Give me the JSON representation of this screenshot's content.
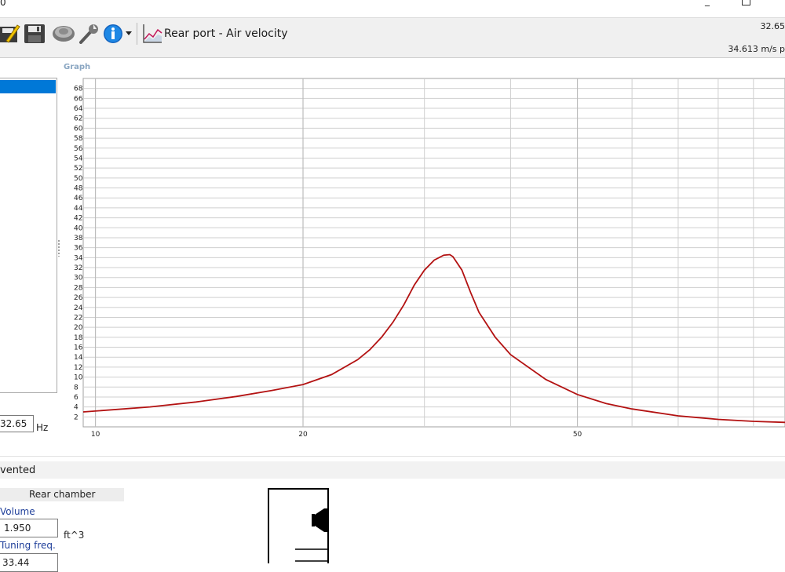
{
  "window": {
    "title_fragment": "0"
  },
  "toolbar": {
    "icons": [
      "edit-icon",
      "save-icon",
      "driver-icon",
      "wrench-icon",
      "info-icon",
      "chevron-down-icon",
      "graph-icon"
    ],
    "chart_title": "Rear port - Air velocity",
    "readout_freq": "32.65",
    "readout_velocity": "34.613 m/s p"
  },
  "graph": {
    "label": "Graph"
  },
  "left_panel": {
    "freq_value": "32.65",
    "freq_unit": "Hz"
  },
  "section": {
    "title": "vented",
    "rear_chamber": {
      "header": "Rear chamber",
      "volume_label": "Volume",
      "volume_value": "1.950",
      "volume_unit": "ft^3",
      "tuning_label": "Tuning freq.",
      "tuning_value": "33.44"
    }
  },
  "colors": {
    "curve": "#b31212",
    "selection": "#0078d7",
    "label_blue": "#1f3f9a",
    "graph_label": "#8aa6c2"
  },
  "chart_data": {
    "type": "line",
    "x_scale": "log",
    "xlim": [
      9.6,
      100
    ],
    "ylim": [
      0,
      70
    ],
    "x_tick_labels": [
      10,
      20,
      50
    ],
    "x_minor_lines": [
      30,
      40,
      60,
      70,
      80,
      90
    ],
    "y_ticks": [
      2,
      4,
      6,
      8,
      10,
      12,
      14,
      16,
      18,
      20,
      22,
      24,
      26,
      28,
      30,
      32,
      34,
      36,
      38,
      40,
      42,
      44,
      46,
      48,
      50,
      52,
      54,
      56,
      58,
      60,
      62,
      64,
      66,
      68
    ],
    "grid": true,
    "series": [
      {
        "color": "#b31212",
        "x": [
          9.6,
          12,
          14,
          16,
          18,
          20,
          22,
          24,
          25,
          26,
          27,
          28,
          29,
          30,
          31,
          32,
          32.65,
          33,
          34,
          35,
          36,
          38,
          40,
          45,
          50,
          55,
          60,
          70,
          80,
          90,
          100
        ],
        "y": [
          3.0,
          4.0,
          5.0,
          6.1,
          7.3,
          8.5,
          10.5,
          13.5,
          15.5,
          18.0,
          21.0,
          24.5,
          28.5,
          31.5,
          33.5,
          34.5,
          34.6,
          34.2,
          31.5,
          27.0,
          23.0,
          18.0,
          14.5,
          9.5,
          6.5,
          4.7,
          3.6,
          2.2,
          1.5,
          1.1,
          0.9
        ]
      }
    ]
  }
}
